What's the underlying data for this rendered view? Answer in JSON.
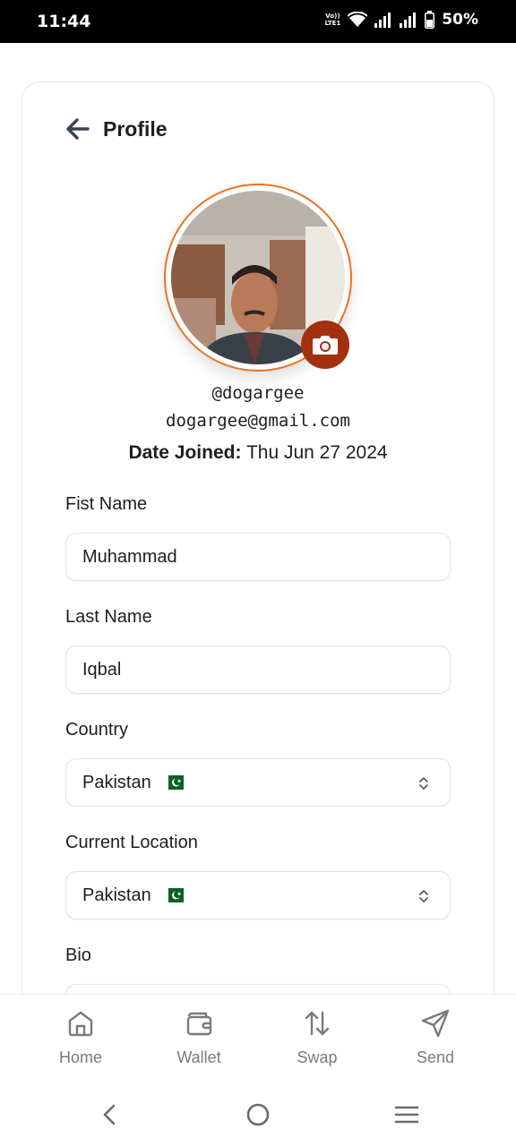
{
  "status_bar": {
    "time": "11:44",
    "network_label": "VoLTE1",
    "battery": "50%"
  },
  "header": {
    "title": "Profile",
    "back_icon": "arrow-left-icon"
  },
  "profile": {
    "username": "@dogargee",
    "email": "dogargee@gmail.com",
    "date_joined_label": "Date Joined:",
    "date_joined_value": "Thu Jun 27 2024",
    "avatar_ring_color": "#e97422",
    "camera_button_color": "#a3300e"
  },
  "form": {
    "first_name": {
      "label": "Fist Name",
      "value": "Muhammad"
    },
    "last_name": {
      "label": "Last Name",
      "value": "Iqbal"
    },
    "country": {
      "label": "Country",
      "value": "Pakistan",
      "flag": "pakistan-flag-icon"
    },
    "current_location": {
      "label": "Current Location",
      "value": "Pakistan",
      "flag": "pakistan-flag-icon"
    },
    "bio": {
      "label": "Bio",
      "value": ""
    }
  },
  "bottom_nav": {
    "items": [
      {
        "label": "Home",
        "icon": "home-icon"
      },
      {
        "label": "Wallet",
        "icon": "wallet-icon"
      },
      {
        "label": "Swap",
        "icon": "swap-icon"
      },
      {
        "label": "Send",
        "icon": "send-icon"
      }
    ]
  },
  "system_nav": {
    "back": "back-icon",
    "home": "home-circle-icon",
    "recents": "menu-icon"
  }
}
